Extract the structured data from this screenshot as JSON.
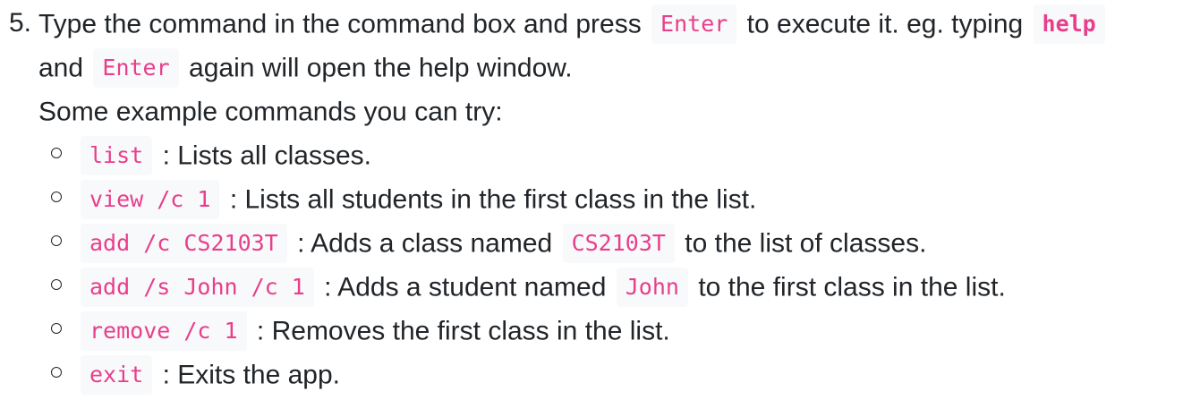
{
  "step": {
    "number": "5.",
    "line1_a": "Type the command in the command box and press",
    "line1_code1": "Enter",
    "line1_b": "to execute it. eg. typing",
    "line1_code2": "help",
    "line2_a": "and",
    "line2_code": "Enter",
    "line2_b": "again will open the help window.",
    "line3": "Some example commands you can try:"
  },
  "commands": [
    {
      "code": "list",
      "desc": ": Lists all classes."
    },
    {
      "code": "view /c 1",
      "desc": ": Lists all students in the first class in the list."
    },
    {
      "code": "add /c CS2103T",
      "desc": ": Adds a class named",
      "code2": "CS2103T",
      "desc2": "to the list of classes."
    },
    {
      "code": "add /s John /c 1",
      "desc": ": Adds a student named",
      "code2": "John",
      "desc2": "to the first class in the list."
    },
    {
      "code": "remove /c 1",
      "desc": ": Removes the first class in the list."
    },
    {
      "code": "exit",
      "desc": ": Exits the app."
    }
  ]
}
